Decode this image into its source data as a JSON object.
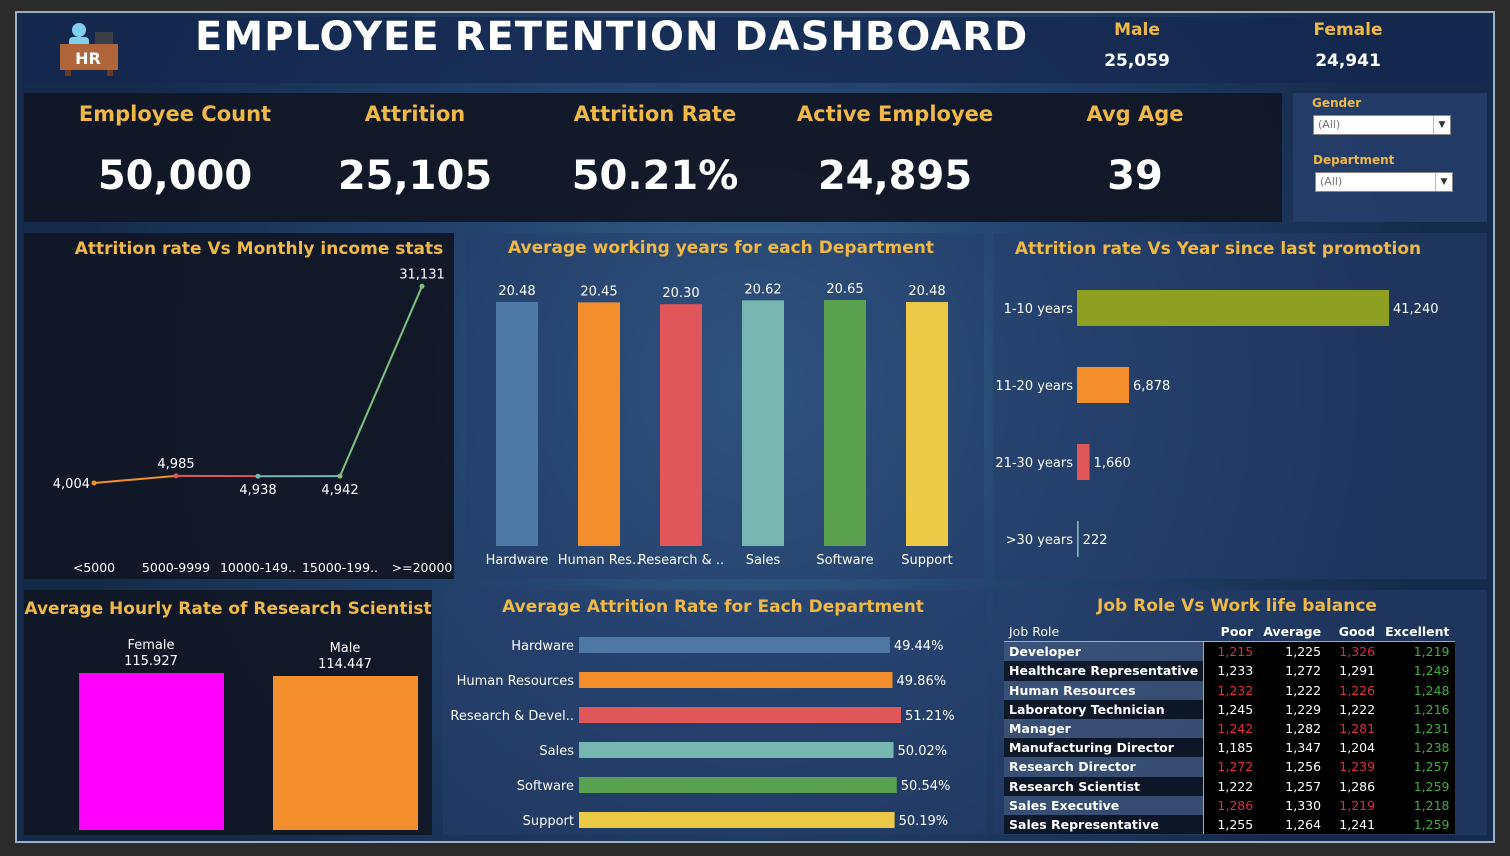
{
  "header": {
    "logo_text": "HR",
    "title": "EMPLOYEE RETENTION DASHBOARD",
    "male_label": "Male",
    "male_value": "25,059",
    "female_label": "Female",
    "female_value": "24,941"
  },
  "kpis": [
    {
      "label": "Employee Count",
      "value": "50,000"
    },
    {
      "label": "Attrition",
      "value": "25,105"
    },
    {
      "label": "Attrition Rate",
      "value": "50.21%"
    },
    {
      "label": "Active Employee",
      "value": "24,895"
    },
    {
      "label": "Avg Age",
      "value": "39"
    }
  ],
  "filters": {
    "gender_label": "Gender",
    "gender_value": "(All)",
    "department_label": "Department",
    "department_value": "(All)"
  },
  "colors": {
    "accent": "#f0b844",
    "blue": "#4e79a7",
    "orange": "#f28e2b",
    "red": "#e15759",
    "teal": "#76b7b2",
    "green": "#59a14f",
    "yellow": "#edc948",
    "olive": "#8ea021",
    "magenta": "#ff00ff"
  },
  "chart_data": [
    {
      "type": "line",
      "title": "Attrition rate Vs Monthly income stats",
      "categories": [
        "<5000",
        "5000-9999",
        "10000-149..",
        "15000-199..",
        ">=20000"
      ],
      "values": [
        4004,
        4985,
        4938,
        4942,
        31131
      ],
      "value_labels": [
        "4,004",
        "4,985",
        "4,938",
        "4,942",
        "31,131"
      ]
    },
    {
      "type": "bar",
      "title": "Average working years for each Department",
      "categories": [
        "Hardware",
        "Human Res..",
        "Research & ..",
        "Sales",
        "Software",
        "Support"
      ],
      "values": [
        20.48,
        20.45,
        20.3,
        20.62,
        20.65,
        20.48
      ],
      "value_labels": [
        "20.48",
        "20.45",
        "20.30",
        "20.62",
        "20.65",
        "20.48"
      ]
    },
    {
      "type": "bar",
      "orientation": "horizontal",
      "title": "Attrition rate Vs Year since last promotion",
      "categories": [
        "1-10 years",
        "11-20 years",
        "21-30 years",
        ">30 years"
      ],
      "values": [
        41240,
        6878,
        1660,
        222
      ],
      "value_labels": [
        "41,240",
        "6,878",
        "1,660",
        "222"
      ]
    },
    {
      "type": "bar",
      "title": "Average Hourly Rate of Research Scientist",
      "categories": [
        "Female",
        "Male"
      ],
      "values": [
        115.927,
        114.447
      ],
      "value_labels": [
        "115.927",
        "114.447"
      ]
    },
    {
      "type": "bar",
      "orientation": "horizontal",
      "title": "Average Attrition Rate for Each Department",
      "categories": [
        "Hardware",
        "Human Resources",
        "Research & Devel..",
        "Sales",
        "Software",
        "Support"
      ],
      "values": [
        49.44,
        49.86,
        51.21,
        50.02,
        50.54,
        50.19
      ],
      "value_labels": [
        "49.44%",
        "49.86%",
        "51.21%",
        "50.02%",
        "50.54%",
        "50.19%"
      ]
    },
    {
      "type": "table",
      "title": "Job Role Vs Work life balance",
      "columns": [
        "Job Role",
        "Poor",
        "Average",
        "Good",
        "Excellent"
      ],
      "rows": [
        [
          "Developer",
          "1,215",
          "1,225",
          "1,326",
          "1,219"
        ],
        [
          "Healthcare Representative",
          "1,233",
          "1,272",
          "1,291",
          "1,249"
        ],
        [
          "Human Resources",
          "1,232",
          "1,222",
          "1,226",
          "1,248"
        ],
        [
          "Laboratory Technician",
          "1,245",
          "1,229",
          "1,222",
          "1,216"
        ],
        [
          "Manager",
          "1,242",
          "1,282",
          "1,281",
          "1,231"
        ],
        [
          "Manufacturing Director",
          "1,185",
          "1,347",
          "1,204",
          "1,238"
        ],
        [
          "Research Director",
          "1,272",
          "1,256",
          "1,239",
          "1,257"
        ],
        [
          "Research Scientist",
          "1,222",
          "1,257",
          "1,286",
          "1,259"
        ],
        [
          "Sales Executive",
          "1,286",
          "1,330",
          "1,219",
          "1,218"
        ],
        [
          "Sales Representative",
          "1,255",
          "1,264",
          "1,241",
          "1,259"
        ]
      ]
    }
  ]
}
